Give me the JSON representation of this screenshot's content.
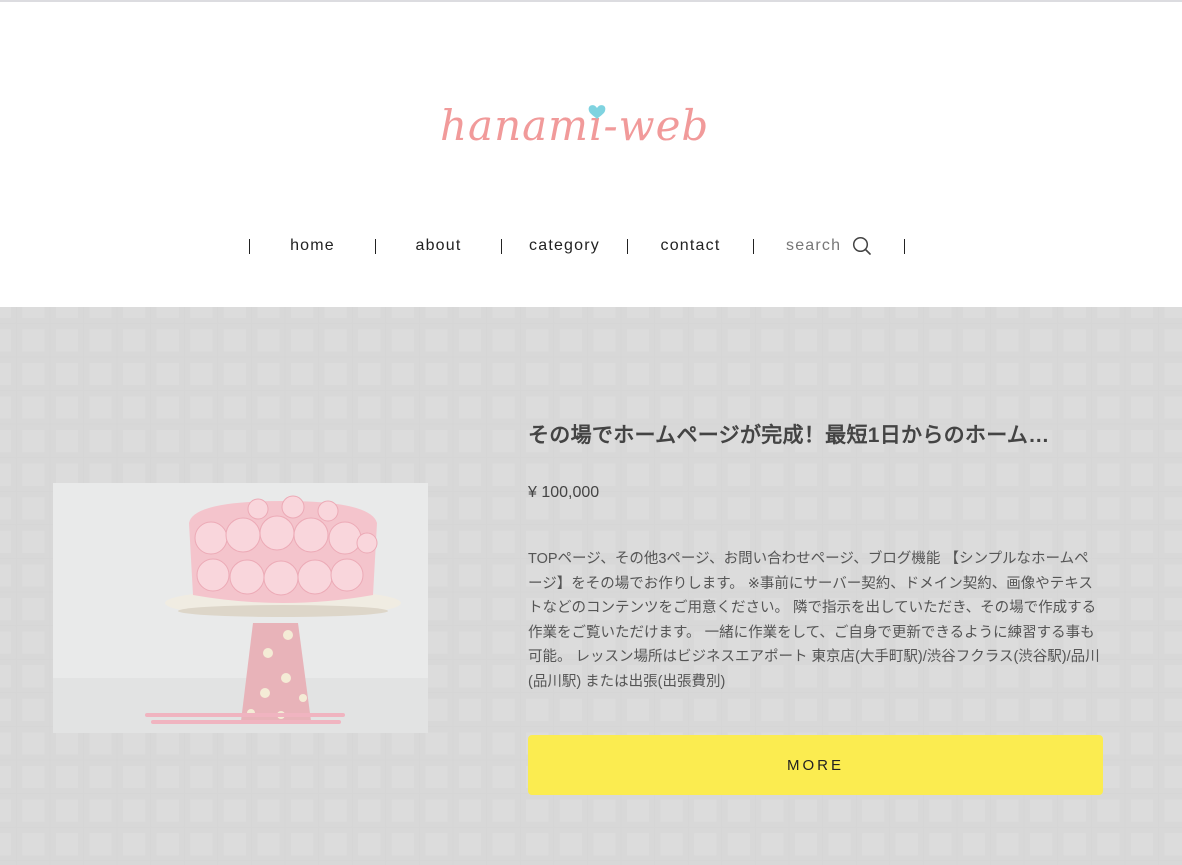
{
  "header": {
    "logo_text": "hanami-web",
    "logo_color": "#f19a9a",
    "logo_heart_color": "#7fd3e0"
  },
  "nav": {
    "items": [
      {
        "label": "home"
      },
      {
        "label": "about"
      },
      {
        "label": "category"
      },
      {
        "label": "contact"
      }
    ],
    "search_placeholder": "search",
    "search_icon": "search-icon"
  },
  "product": {
    "title": "その場でホームページが完成！最短1日からのホーム…",
    "price": "¥ 100,000",
    "description": "TOPページ、その他3ページ、お問い合わせページ、ブログ機能 【シンプルなホームページ】をその場でお作りします。 ※事前にサーバー契約、ドメイン契約、画像やテキストなどのコンテンツをご用意ください。 隣で指示を出していただき、その場で作成する作業をご覧いただけます。 一緒に作業をして、ご自身で更新できるように練習する事も可能。 レッスン場所はビジネスエアポート 東京店(大手町駅)/渋谷フクラス(渋谷駅)/品川(品川駅) または出張(出張費別)",
    "image_alt": "pink rose cake on polka-dot stand",
    "more_label": "MORE",
    "more_color": "#fbec50"
  }
}
